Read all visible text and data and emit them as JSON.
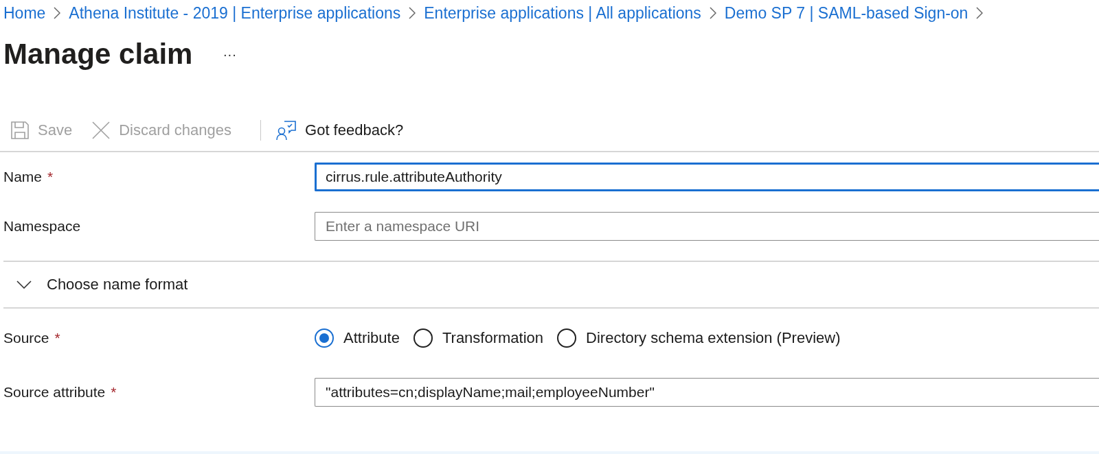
{
  "breadcrumb": [
    {
      "label": "Home"
    },
    {
      "label": "Athena Institute - 2019 | Enterprise applications"
    },
    {
      "label": "Enterprise applications | All applications"
    },
    {
      "label": "Demo SP 7 | SAML-based Sign-on"
    }
  ],
  "title": "Manage claim",
  "more": "···",
  "toolbar": [
    {
      "kind": "save",
      "label": "Save",
      "disabled": true
    },
    {
      "kind": "discard",
      "label": "Discard changes",
      "disabled": true
    },
    {
      "kind": "feedback",
      "label": "Got feedback?",
      "disabled": false
    }
  ],
  "fields_top": [
    {
      "label": "Name",
      "required_mark": "*",
      "value": "cirrus.rule.attributeAuthority",
      "focused": true
    },
    {
      "label": "Namespace",
      "placeholder": "Enter a namespace URI",
      "focused": false
    }
  ],
  "section": {
    "label": "Choose name format",
    "expanded": false
  },
  "source": {
    "label": "Source",
    "required_mark": "*",
    "options": [
      {
        "label": "Attribute",
        "selected": true
      },
      {
        "label": "Transformation",
        "selected": false
      },
      {
        "label": "Directory schema extension (Preview)",
        "selected": false
      }
    ]
  },
  "fields_bottom": [
    {
      "label": "Source attribute",
      "required_mark": "*",
      "value": "\"attributes=cn;displayName;mail;employeeNumber\"",
      "focused": false
    }
  ]
}
